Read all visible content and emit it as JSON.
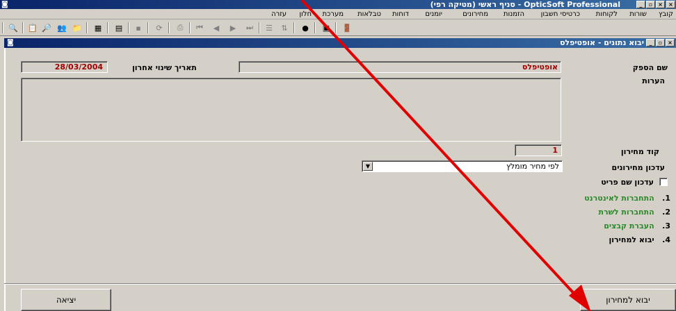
{
  "app": {
    "title": "OpticSoft Professional - סניף ראשי (מטיקה רפי)"
  },
  "menu": [
    "קובץ",
    "שורות",
    "לקוחות",
    "כרטיסי חשבון",
    "הזמנות",
    "מחירונים",
    "יומנים",
    "דוחות",
    "טבלאות",
    "מערכת",
    "חלון",
    "עזרה"
  ],
  "toolbar_icons": [
    "exit-door-icon",
    "table-icon",
    "print-icon",
    "preview-icon",
    "sort-icon",
    "filter-icon",
    "last-record-icon",
    "next-record-icon",
    "prev-record-icon",
    "first-record-icon",
    "print-icon",
    "refresh-icon",
    "save-icon",
    "grid-icon",
    "calculator-icon",
    "folder-icon",
    "magnify-icon",
    "properties-icon",
    "search-icon"
  ],
  "child_window": {
    "title": "יבוא נתונים - אופטיפלס"
  },
  "form": {
    "supplier_label": "שם הספק",
    "supplier_value": "אופטיפלס",
    "last_change_label": "תאריך שינוי אחרון",
    "last_change_value": "28/03/2004",
    "notes_label": "הערות",
    "notes_value": "",
    "pricelist_code_label": "קוד מחירון",
    "pricelist_code_value": "1",
    "pricelist_update_label": "עדכון מחירונים",
    "pricelist_update_value": "לפי מחיר מומלץ",
    "update_item_name_label": "עדכון שם פריט",
    "update_item_name_checked": false
  },
  "steps": [
    {
      "num": "1.",
      "label": "התחברות לאינטרנט",
      "color": "#2a8a2a"
    },
    {
      "num": "2.",
      "label": "התחברות לשרת",
      "color": "#2a8a2a"
    },
    {
      "num": "3.",
      "label": "העברת קבצים",
      "color": "#2a8a2a"
    },
    {
      "num": "4.",
      "label": "יבוא למחירון",
      "color": "#000000"
    }
  ],
  "buttons": {
    "import": "יבוא למחירון",
    "exit": "יציאה"
  },
  "colors": {
    "title_start": "#0a246a",
    "title_end": "#3a6ea5",
    "accent_red": "#a00000",
    "arrow": "#e00000"
  }
}
